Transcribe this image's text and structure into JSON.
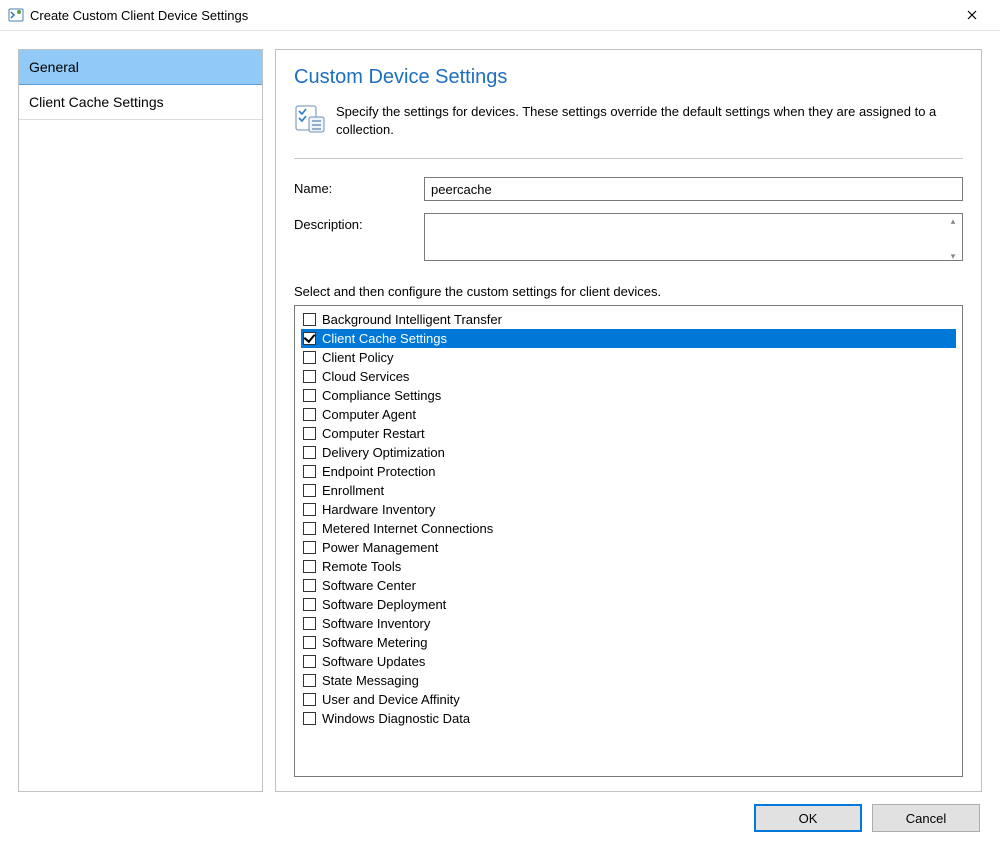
{
  "window": {
    "title": "Create Custom Client Device Settings"
  },
  "sidebar": {
    "items": [
      {
        "label": "General",
        "selected": true
      },
      {
        "label": "Client Cache Settings",
        "selected": false
      }
    ]
  },
  "main": {
    "heading": "Custom Device Settings",
    "intro": "Specify the settings for devices. These settings override the default settings when they are assigned to a collection.",
    "name_label": "Name:",
    "name_value": "peercache",
    "description_label": "Description:",
    "description_value": "",
    "instruction": "Select and then configure the custom settings for client devices.",
    "settings": [
      {
        "label": "Background Intelligent Transfer",
        "checked": false,
        "selected": false
      },
      {
        "label": "Client Cache Settings",
        "checked": true,
        "selected": true
      },
      {
        "label": "Client Policy",
        "checked": false,
        "selected": false
      },
      {
        "label": "Cloud Services",
        "checked": false,
        "selected": false
      },
      {
        "label": "Compliance Settings",
        "checked": false,
        "selected": false
      },
      {
        "label": "Computer Agent",
        "checked": false,
        "selected": false
      },
      {
        "label": "Computer Restart",
        "checked": false,
        "selected": false
      },
      {
        "label": "Delivery Optimization",
        "checked": false,
        "selected": false
      },
      {
        "label": "Endpoint Protection",
        "checked": false,
        "selected": false
      },
      {
        "label": "Enrollment",
        "checked": false,
        "selected": false
      },
      {
        "label": "Hardware Inventory",
        "checked": false,
        "selected": false
      },
      {
        "label": "Metered Internet Connections",
        "checked": false,
        "selected": false
      },
      {
        "label": "Power Management",
        "checked": false,
        "selected": false
      },
      {
        "label": "Remote Tools",
        "checked": false,
        "selected": false
      },
      {
        "label": "Software Center",
        "checked": false,
        "selected": false
      },
      {
        "label": "Software Deployment",
        "checked": false,
        "selected": false
      },
      {
        "label": "Software Inventory",
        "checked": false,
        "selected": false
      },
      {
        "label": "Software Metering",
        "checked": false,
        "selected": false
      },
      {
        "label": "Software Updates",
        "checked": false,
        "selected": false
      },
      {
        "label": "State Messaging",
        "checked": false,
        "selected": false
      },
      {
        "label": "User and Device Affinity",
        "checked": false,
        "selected": false
      },
      {
        "label": "Windows Diagnostic Data",
        "checked": false,
        "selected": false
      }
    ]
  },
  "buttons": {
    "ok": "OK",
    "cancel": "Cancel"
  }
}
